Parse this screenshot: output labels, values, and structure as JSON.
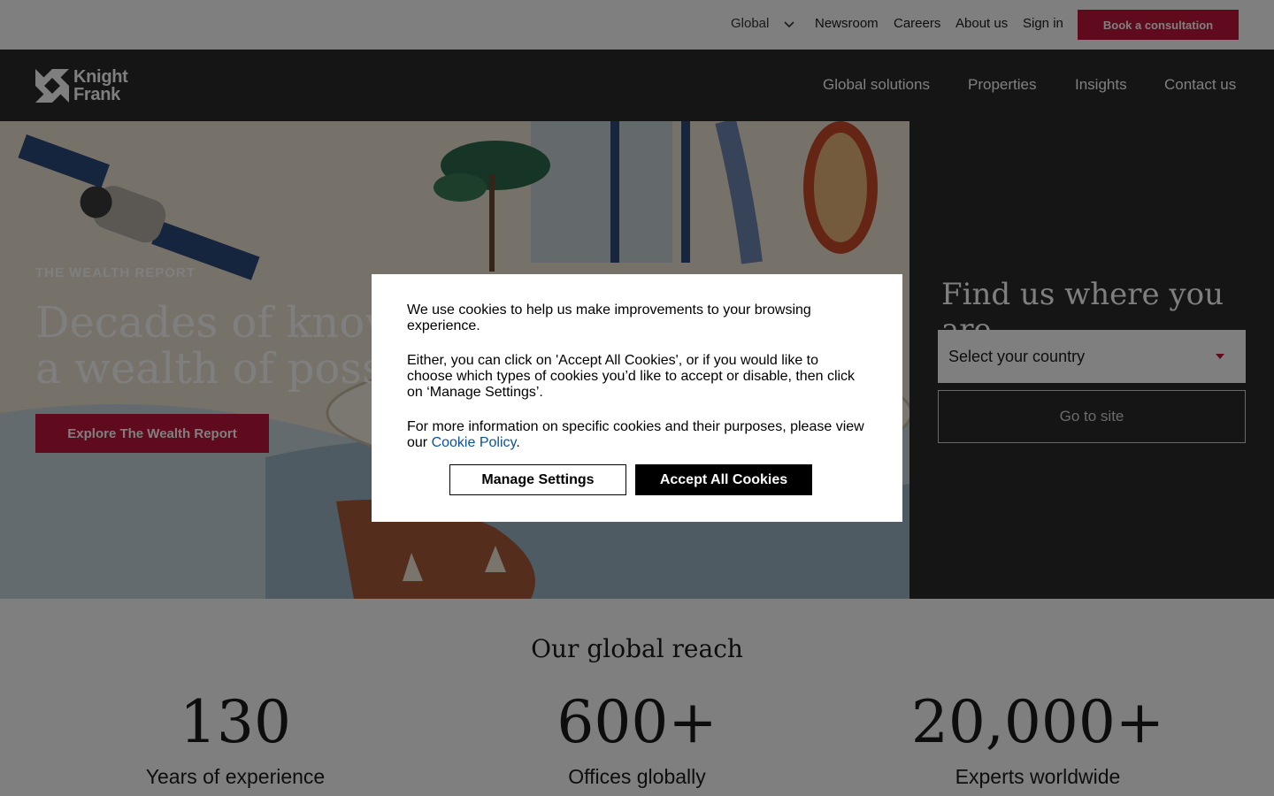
{
  "topbar": {
    "region_label": "Global",
    "links": [
      "Newsroom",
      "Careers",
      "About us",
      "Sign in"
    ],
    "cta_label": "Book a consultation"
  },
  "brand": {
    "logo_line1": "Knight",
    "logo_line2": "Frank"
  },
  "mainnav": {
    "items": [
      "Global solutions",
      "Properties",
      "Insights",
      "Contact us"
    ]
  },
  "hero": {
    "eyebrow": "THE WEALTH REPORT",
    "headline_line1": "Decades of knowl",
    "headline_line2": "a wealth of possib",
    "cta_label": "Explore The Wealth Report"
  },
  "finder": {
    "title": "Find us where you are",
    "select_value": "Select your country",
    "go_label": "Go to site"
  },
  "stats": {
    "heading": "Our global reach",
    "items": [
      {
        "value": "130",
        "label": "Years of experience"
      },
      {
        "value": "600+",
        "label": "Offices globally"
      },
      {
        "value": "20,000+",
        "label": "Experts worldwide"
      }
    ]
  },
  "cookie": {
    "p1": "We use cookies to help us make improvements to your browsing experience.",
    "p2": "Either, you can click on 'Accept All Cookies', or if you would like to choose which types of cookies you’d like to accept or disable, then click on ‘Manage Settings’.",
    "p3_prefix": "For more information on specific cookies and their purposes, please view our",
    "policy_link": "Cookie Policy",
    "p3_suffix": ".",
    "manage_label": "Manage Settings",
    "accept_label": "Accept All Cookies"
  },
  "colors": {
    "brand_red": "#c1143b",
    "nav_dark": "#2a2a2a",
    "link_blue": "#0b5394"
  },
  "icons": [
    "chevron-down-icon",
    "knight-frank-logo-icon",
    "caret-down-icon"
  ]
}
